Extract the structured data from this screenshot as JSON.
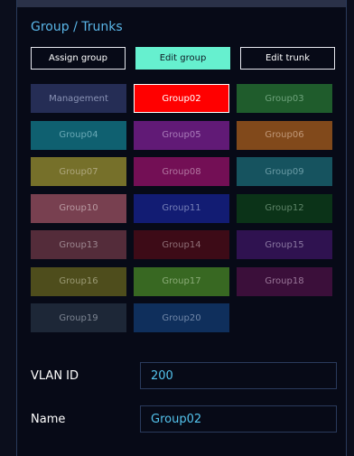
{
  "panel": {
    "title": "Group / Trunks"
  },
  "buttons": {
    "assign_group": "Assign group",
    "edit_group": "Edit group",
    "edit_trunk": "Edit trunk"
  },
  "groups": [
    {
      "label": "Management",
      "color": "#252d55",
      "text_color": "#8a93b5"
    },
    {
      "label": "Group02",
      "color": "#ff0000",
      "text_color": "#ffffff",
      "selected": true
    },
    {
      "label": "Group03",
      "color": "#1f5c2c",
      "text_color": "#6ea27b"
    },
    {
      "label": "Group04",
      "color": "#0f6070",
      "text_color": "#6aa9b6"
    },
    {
      "label": "Group05",
      "color": "#611a76",
      "text_color": "#a97bb9"
    },
    {
      "label": "Group06",
      "color": "#81491b",
      "text_color": "#c09878"
    },
    {
      "label": "Group07",
      "color": "#76702a",
      "text_color": "#aea77d"
    },
    {
      "label": "Group08",
      "color": "#730f55",
      "text_color": "#b276a1"
    },
    {
      "label": "Group09",
      "color": "#16535f",
      "text_color": "#6a9ba5"
    },
    {
      "label": "Group10",
      "color": "#784050",
      "text_color": "#b99aa2"
    },
    {
      "label": "Group11",
      "color": "#121c73",
      "text_color": "#7680b8"
    },
    {
      "label": "Group12",
      "color": "#0b3318",
      "text_color": "#5f8569"
    },
    {
      "label": "Group13",
      "color": "#542c3a",
      "text_color": "#9d8790"
    },
    {
      "label": "Group14",
      "color": "#3d0b17",
      "text_color": "#8e6e76"
    },
    {
      "label": "Group15",
      "color": "#2f1250",
      "text_color": "#8a78a1"
    },
    {
      "label": "Group16",
      "color": "#4e4d1c",
      "text_color": "#9b9a74"
    },
    {
      "label": "Group17",
      "color": "#386822",
      "text_color": "#8aab77"
    },
    {
      "label": "Group18",
      "color": "#3b0f3a",
      "text_color": "#9a7799"
    },
    {
      "label": "Group19",
      "color": "#1d2737",
      "text_color": "#7d8592"
    },
    {
      "label": "Group20",
      "color": "#0f2f5c",
      "text_color": "#7187a8"
    }
  ],
  "fields": {
    "vlan_label": "VLAN ID",
    "vlan_value": "200",
    "name_label": "Name",
    "name_value": "Group02"
  },
  "colors": {
    "accent": "#66f0cf",
    "title": "#5ab6e8",
    "input_text": "#54c4ee"
  }
}
